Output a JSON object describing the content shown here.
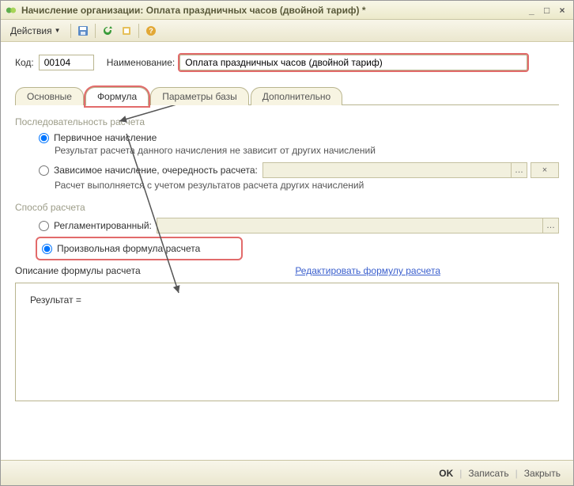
{
  "window": {
    "title": "Начисление организации: Оплата праздничных часов (двойной тариф) *"
  },
  "toolbar": {
    "actions_label": "Действия"
  },
  "fields": {
    "code_label": "Код:",
    "code_value": "00104",
    "name_label": "Наименование:",
    "name_value": "Оплата праздничных часов (двойной тариф)"
  },
  "tabs": {
    "t1": "Основные",
    "t2": "Формула",
    "t3": "Параметры базы",
    "t4": "Дополнительно"
  },
  "seq": {
    "section": "Последовательность расчета",
    "r1_label": "Первичное начисление",
    "r1_desc": "Результат расчета данного начисления не зависит от других начислений",
    "r2_label": "Зависимое начисление, очередность расчета:",
    "r2_desc": "Расчет выполняется с учетом результатов расчета других начислений"
  },
  "method": {
    "section": "Способ расчета",
    "r1_label": "Регламентированный:",
    "r2_label": "Произвольная формула расчета"
  },
  "formula": {
    "label": "Описание формулы расчета",
    "edit_link": "Редактировать формулу расчета",
    "body": "Результат ="
  },
  "footer": {
    "ok": "OK",
    "save": "Записать",
    "close": "Закрыть"
  }
}
